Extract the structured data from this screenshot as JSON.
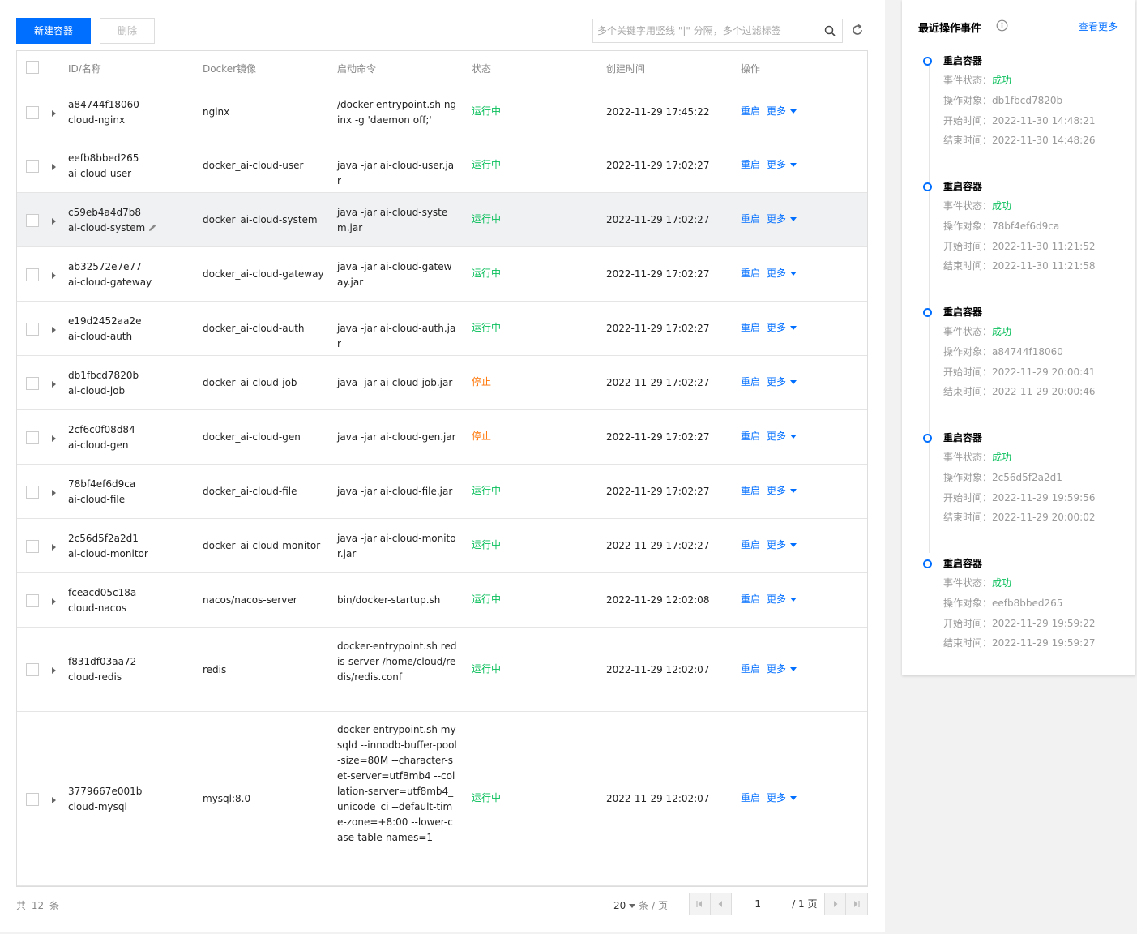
{
  "toolbar": {
    "create_label": "新建容器",
    "delete_label": "删除",
    "search_placeholder": "多个关键字用竖线 \"|\" 分隔，多个过滤标签"
  },
  "columns": [
    "ID/名称",
    "Docker镜像",
    "启动命令",
    "状态",
    "创建时间",
    "操作"
  ],
  "actions": {
    "restart": "重启",
    "more": "更多"
  },
  "rows": [
    {
      "id": "a84744f18060",
      "name": "cloud-nginx",
      "image": "nginx",
      "cmd": "/docker-entrypoint.sh nginx -g 'daemon off;'",
      "status": "运行中",
      "status_type": "run",
      "created": "2022-11-29 17:45:22"
    },
    {
      "id": "eefb8bbed265",
      "name": "ai-cloud-user",
      "image": "docker_ai-cloud-user",
      "cmd": "java -jar ai-cloud-user.jar",
      "status": "运行中",
      "status_type": "run",
      "created": "2022-11-29 17:02:27"
    },
    {
      "id": "c59eb4a4d7b8",
      "name": "ai-cloud-system",
      "image": "docker_ai-cloud-system",
      "cmd": "java -jar ai-cloud-system.jar",
      "status": "运行中",
      "status_type": "run",
      "created": "2022-11-29 17:02:27"
    },
    {
      "id": "ab32572e7e77",
      "name": "ai-cloud-gateway",
      "image": "docker_ai-cloud-gateway",
      "cmd": "java -jar ai-cloud-gateway.jar",
      "status": "运行中",
      "status_type": "run",
      "created": "2022-11-29 17:02:27"
    },
    {
      "id": "e19d2452aa2e",
      "name": "ai-cloud-auth",
      "image": "docker_ai-cloud-auth",
      "cmd": "java -jar ai-cloud-auth.jar",
      "status": "运行中",
      "status_type": "run",
      "created": "2022-11-29 17:02:27"
    },
    {
      "id": "db1fbcd7820b",
      "name": "ai-cloud-job",
      "image": "docker_ai-cloud-job",
      "cmd": "java -jar ai-cloud-job.jar",
      "status": "停止",
      "status_type": "stop",
      "created": "2022-11-29 17:02:27"
    },
    {
      "id": "2cf6c0f08d84",
      "name": "ai-cloud-gen",
      "image": "docker_ai-cloud-gen",
      "cmd": "java -jar ai-cloud-gen.jar",
      "status": "停止",
      "status_type": "stop",
      "created": "2022-11-29 17:02:27"
    },
    {
      "id": "78bf4ef6d9ca",
      "name": "ai-cloud-file",
      "image": "docker_ai-cloud-file",
      "cmd": "java -jar ai-cloud-file.jar",
      "status": "运行中",
      "status_type": "run",
      "created": "2022-11-29 17:02:27"
    },
    {
      "id": "2c56d5f2a2d1",
      "name": "ai-cloud-monitor",
      "image": "docker_ai-cloud-monitor",
      "cmd": "java -jar ai-cloud-monitor.jar",
      "status": "运行中",
      "status_type": "run",
      "created": "2022-11-29 17:02:27"
    },
    {
      "id": "fceacd05c18a",
      "name": "cloud-nacos",
      "image": "nacos/nacos-server",
      "cmd": "bin/docker-startup.sh",
      "status": "运行中",
      "status_type": "run",
      "created": "2022-11-29 12:02:08"
    },
    {
      "id": "f831df03aa72",
      "name": "cloud-redis",
      "image": "redis",
      "cmd": "docker-entrypoint.sh redis-server /home/cloud/redis/redis.conf",
      "status": "运行中",
      "status_type": "run",
      "created": "2022-11-29 12:02:07"
    },
    {
      "id": "3779667e001b",
      "name": "cloud-mysql",
      "image": "mysql:8.0",
      "cmd": "docker-entrypoint.sh mysqld --innodb-buffer-pool-size=80M --character-set-server=utf8mb4 --collation-server=utf8mb4_unicode_ci --default-time-zone=+8:00 --lower-case-table-names=1",
      "status": "运行中",
      "status_type": "run",
      "created": "2022-11-29 12:02:07"
    }
  ],
  "footer": {
    "total_prefix": "共",
    "total_count": "12",
    "total_suffix": "条",
    "page_size": "20",
    "page_size_unit": "条 / 页",
    "current_page": "1",
    "total_pages": "/ 1 页"
  },
  "side": {
    "title": "最近操作事件",
    "more_label": "查看更多",
    "labels": {
      "status": "事件状态：",
      "target": "操作对象：",
      "start": "开始时间：",
      "end": "结束时间："
    },
    "events": [
      {
        "title": "重启容器",
        "status": "成功",
        "target": "db1fbcd7820b",
        "start": "2022-11-30 14:48:21",
        "end": "2022-11-30 14:48:26"
      },
      {
        "title": "重启容器",
        "status": "成功",
        "target": "78bf4ef6d9ca",
        "start": "2022-11-30 11:21:52",
        "end": "2022-11-30 11:21:58"
      },
      {
        "title": "重启容器",
        "status": "成功",
        "target": "a84744f18060",
        "start": "2022-11-29 20:00:41",
        "end": "2022-11-29 20:00:46"
      },
      {
        "title": "重启容器",
        "status": "成功",
        "target": "2c56d5f2a2d1",
        "start": "2022-11-29 19:59:56",
        "end": "2022-11-29 20:00:02"
      },
      {
        "title": "重启容器",
        "status": "成功",
        "target": "eefb8bbed265",
        "start": "2022-11-29 19:59:22",
        "end": "2022-11-29 19:59:27"
      }
    ]
  },
  "colors": {
    "primary": "#006eff",
    "running": "#0abf5b",
    "stopped": "#ff7200"
  }
}
